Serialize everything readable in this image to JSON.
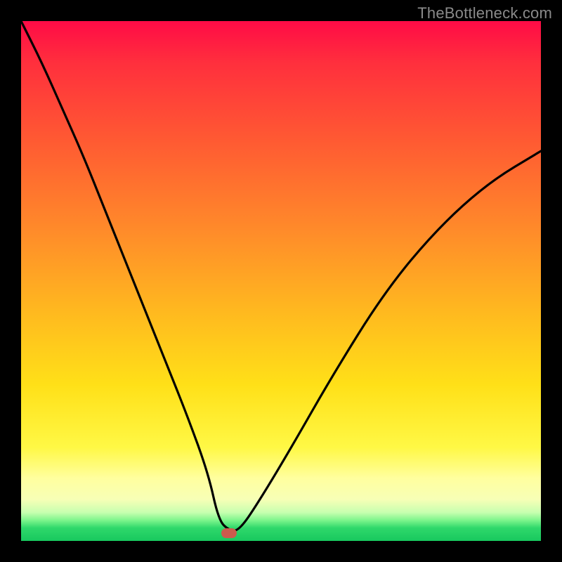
{
  "watermark": "TheBottleneck.com",
  "chart_data": {
    "type": "line",
    "title": "",
    "xlabel": "",
    "ylabel": "",
    "xlim": [
      0,
      100
    ],
    "ylim": [
      0,
      100
    ],
    "grid": false,
    "background": "red-yellow-green vertical gradient",
    "marker": {
      "x": 40,
      "y": 1.5,
      "shape": "rounded-rect",
      "color": "#cc5b4d"
    },
    "series": [
      {
        "name": "bottleneck-curve",
        "color": "#000000",
        "x": [
          0,
          4,
          8,
          12,
          16,
          20,
          24,
          28,
          32,
          36,
          38,
          40,
          42,
          46,
          52,
          60,
          70,
          80,
          90,
          100
        ],
        "y": [
          100,
          92,
          83,
          74,
          64,
          54,
          44,
          34,
          24,
          13,
          4,
          2,
          2,
          8,
          18,
          32,
          48,
          60,
          69,
          75
        ]
      }
    ]
  }
}
